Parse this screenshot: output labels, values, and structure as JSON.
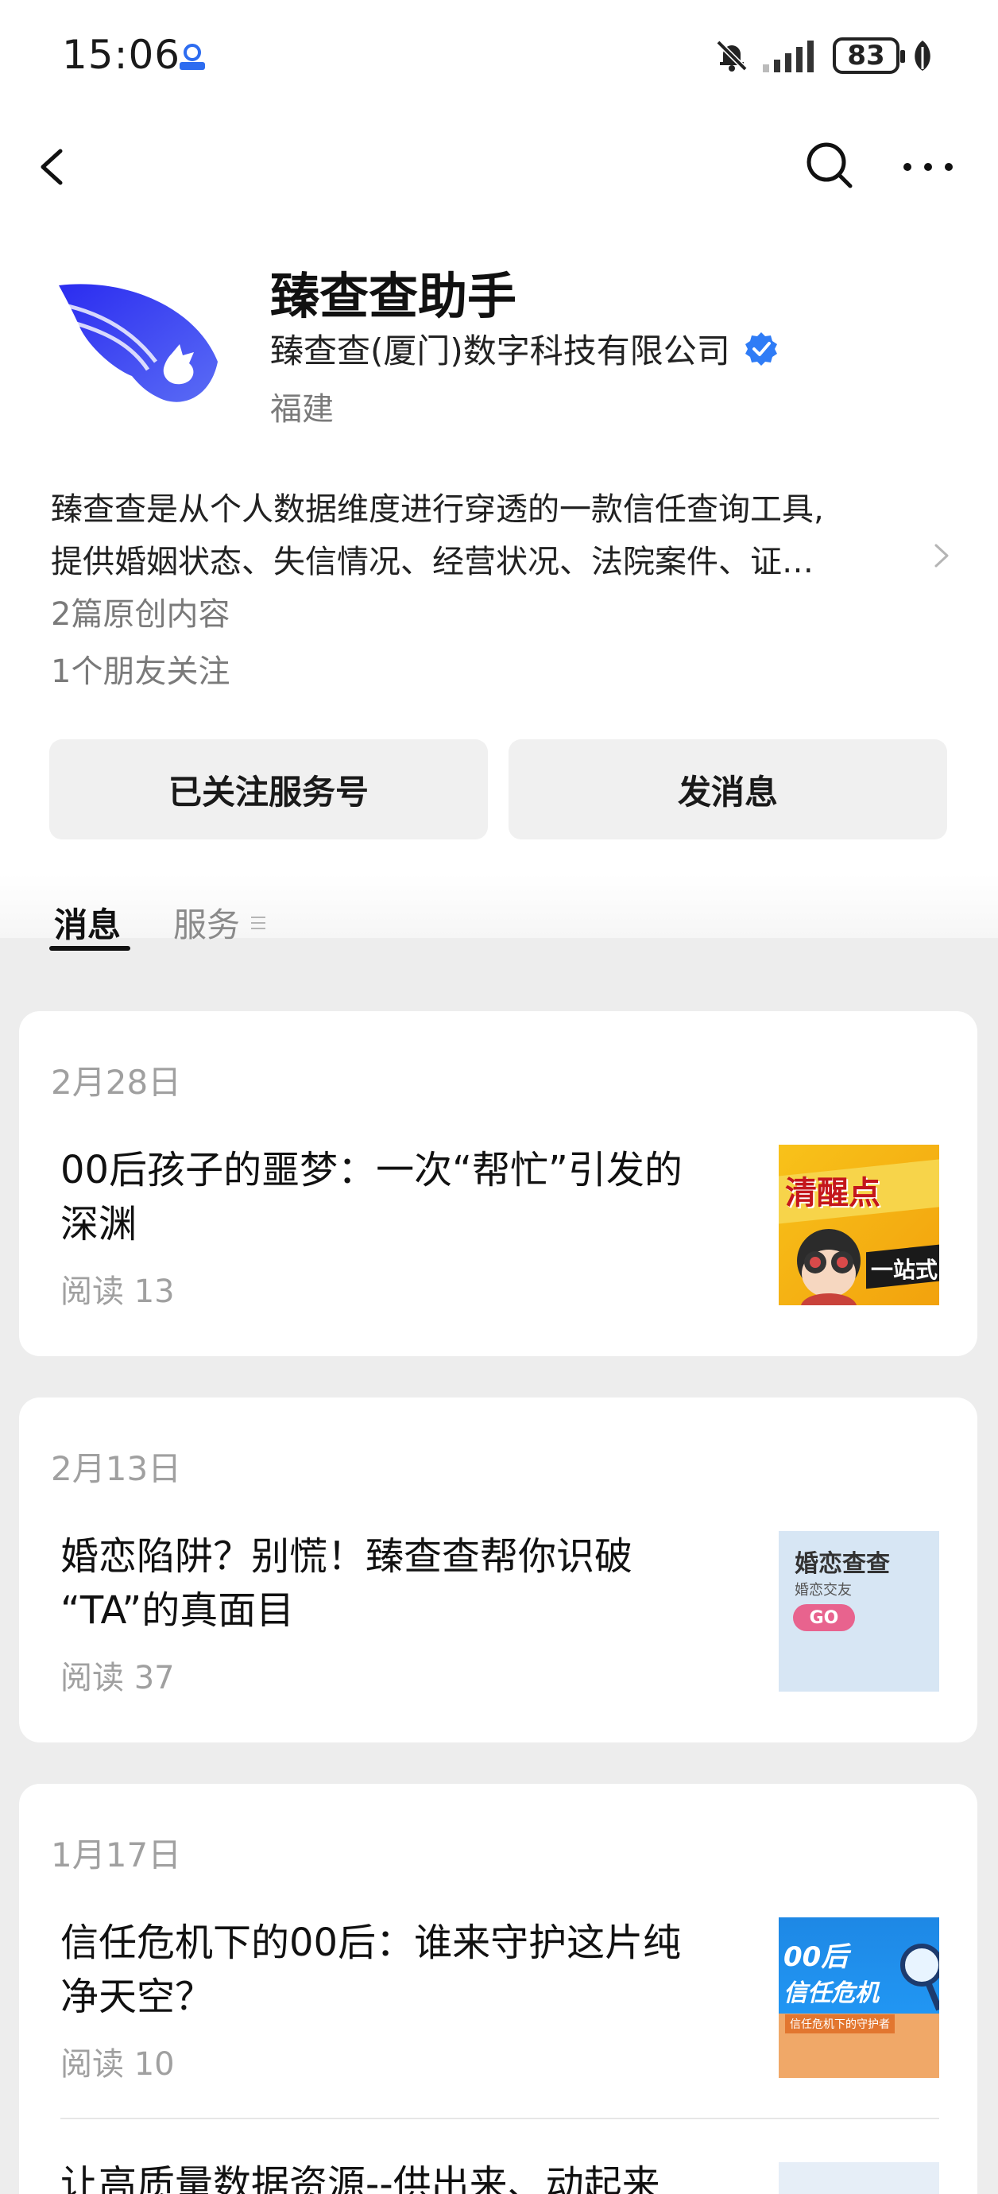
{
  "status_bar": {
    "time": "15:06",
    "battery": "83",
    "icons": [
      "location-badge-icon",
      "bell-muted-icon",
      "signal-icon",
      "battery-icon",
      "leaf-icon"
    ]
  },
  "nav": {
    "icons": [
      "back-icon",
      "search-icon",
      "more-icon"
    ]
  },
  "account": {
    "name": "臻查查助手",
    "company": "臻查查(厦门)数字科技有限公司",
    "region": "福建",
    "description_line1": "臻查查是从个人数据维度进行穿透的一款信任查询工具,",
    "description_line2": "提供婚姻状态、失信情况、经营状况、法院案件、证…",
    "original_count": "2篇原创内容",
    "friends_following": "1个朋友关注",
    "brand_color": "#3a3be8",
    "verified_color": "#2f7cf6"
  },
  "buttons": {
    "follow": "已关注服务号",
    "message": "发消息"
  },
  "tabs": {
    "messages": "消息",
    "services": "服务"
  },
  "cards": [
    {
      "date": "2月28日",
      "articles": [
        {
          "title_line1": "00后孩子的噩梦：一次“帮忙”引发的",
          "title_line2": "深渊",
          "read": "阅读 13",
          "thumb_text": "清醒点",
          "thumb_sub": "一站式"
        }
      ]
    },
    {
      "date": "2月13日",
      "articles": [
        {
          "title_line1": "婚恋陷阱？别慌！臻查查帮你识破",
          "title_line2": "“TA”的真面目",
          "read": "阅读 37",
          "thumb_text": "婚恋查查",
          "thumb_sub": "婚恋交友",
          "thumb_btn": "GO"
        }
      ]
    },
    {
      "date": "1月17日",
      "articles": [
        {
          "title_line1": "信任危机下的00后：谁来守护这片纯",
          "title_line2": "净天空？",
          "read": "阅读 10",
          "thumb_text": "00后",
          "thumb_sub": "信任危机",
          "thumb_small": "信任危机下的守护者"
        },
        {
          "title_line1": "让高质量数据资源--供出来、动起来"
        }
      ]
    }
  ]
}
